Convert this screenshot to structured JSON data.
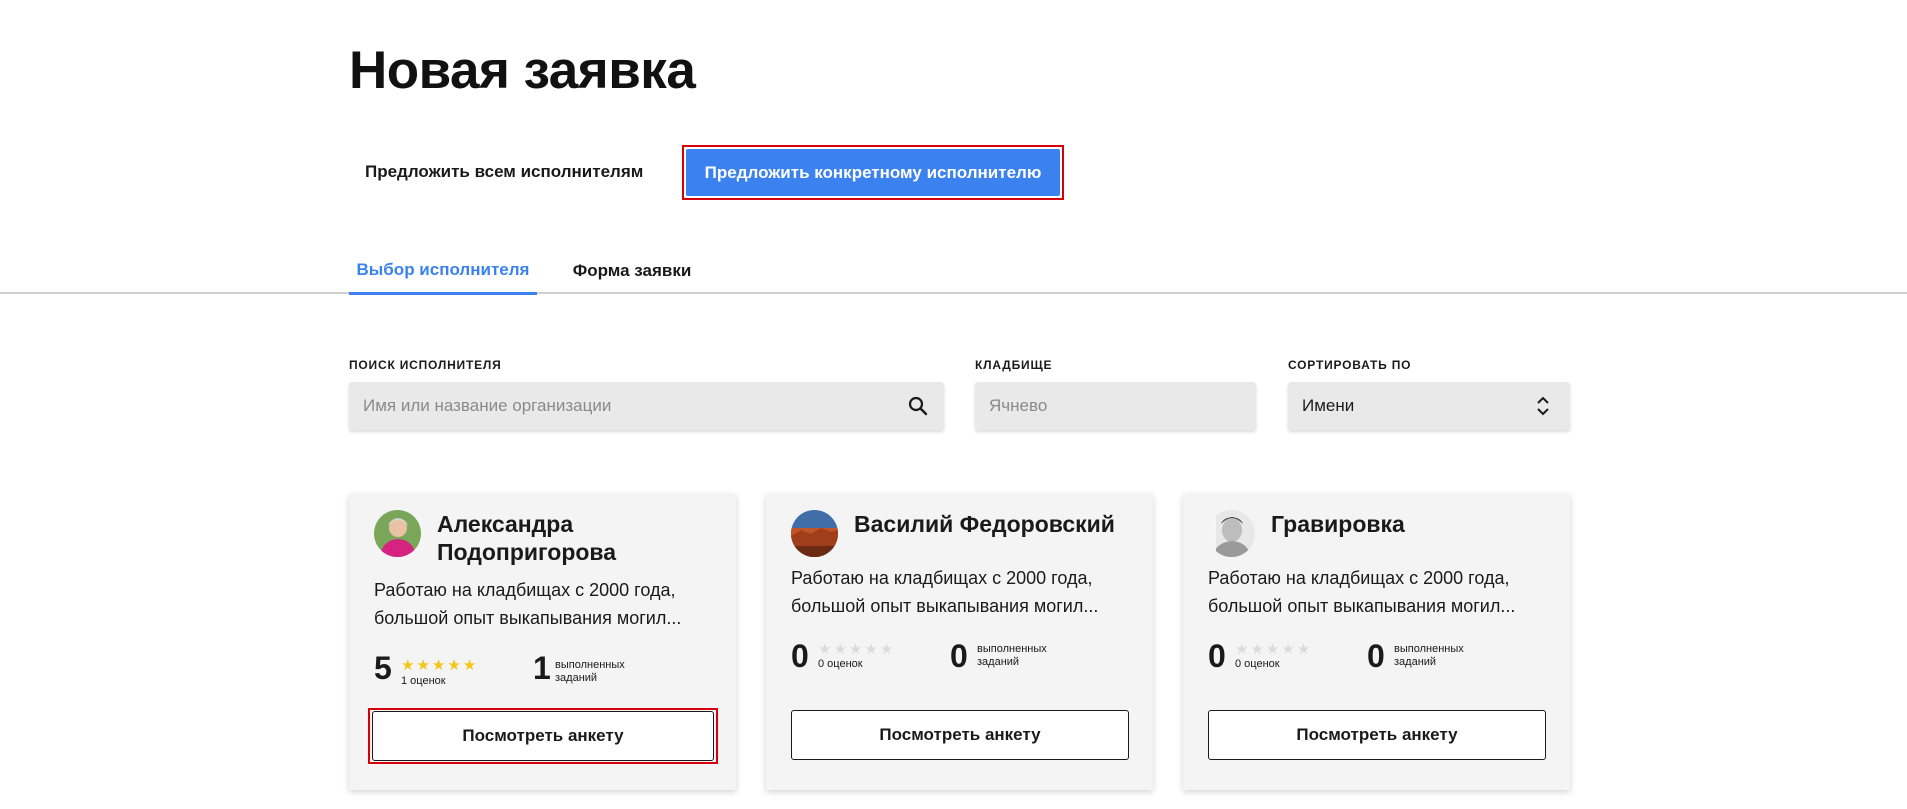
{
  "page": {
    "title": "Новая заявка"
  },
  "offer": {
    "all_label": "Предложить всем исполнителям",
    "specific_label": "Предложить конкретному исполнителю"
  },
  "tabs": [
    {
      "label": "Выбор исполнителя",
      "active": true
    },
    {
      "label": "Форма заявки",
      "active": false
    }
  ],
  "filters": {
    "search": {
      "label": "ПОИСК ИСПОЛНИТЕЛЯ",
      "placeholder": "Имя или название организации",
      "value": ""
    },
    "cemetery": {
      "label": "КЛАДБИЩЕ",
      "placeholder": "Ячнево",
      "value": ""
    },
    "sort": {
      "label": "СОРТИРОВАТЬ ПО",
      "value": "Имени"
    }
  },
  "cards": [
    {
      "name_line1": "Александра",
      "name_line2": "Подопригорова",
      "desc_line1": "Работаю на кладбищах с 2000 года,",
      "desc_line2": "большой опыт выкапывания могил...",
      "rating": "5",
      "stars_filled": 5,
      "ratings_count": "1 оценок",
      "jobs": "1",
      "jobs_label_1": "выполненных",
      "jobs_label_2": "заданий",
      "button": "Посмотреть анкету"
    },
    {
      "name_line1": "Василий Федоровский",
      "name_line2": "",
      "desc_line1": "Работаю на кладбищах с 2000 года,",
      "desc_line2": "большой опыт выкапывания могил...",
      "rating": "0",
      "stars_filled": 0,
      "ratings_count": "0 оценок",
      "jobs": "0",
      "jobs_label_1": "выполненных",
      "jobs_label_2": "заданий",
      "button": "Посмотреть анкету"
    },
    {
      "name_line1": "Гравировка",
      "name_line2": "",
      "desc_line1": "Работаю на кладбищах с 2000 года,",
      "desc_line2": "большой опыт выкапывания могил...",
      "rating": "0",
      "stars_filled": 0,
      "ratings_count": "0 оценок",
      "jobs": "0",
      "jobs_label_1": "выполненных",
      "jobs_label_2": "заданий",
      "button": "Посмотреть анкету"
    }
  ],
  "icons": {
    "search": "search-icon",
    "sort": "sort-arrows-icon"
  },
  "colors": {
    "accent": "#3c82ef",
    "highlight": "#d6000d",
    "star": "#f5c518"
  }
}
